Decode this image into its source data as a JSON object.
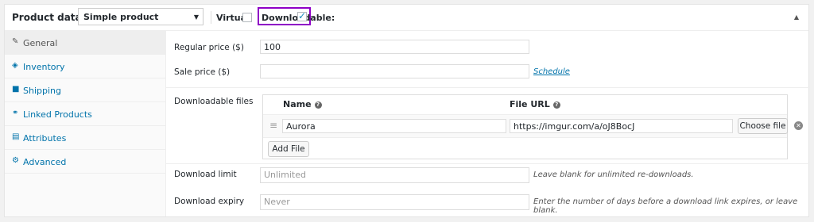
{
  "header": {
    "title": "Product data —",
    "product_type": "Simple product",
    "virtual_label": "Virtual:",
    "downloadable_label": "Downloadable:",
    "virtual_checked": false,
    "downloadable_checked": true,
    "highlight_color": "#8e00c6"
  },
  "sidebar": {
    "items": [
      {
        "label": "General",
        "icon": "wrench-icon",
        "active": true
      },
      {
        "label": "Inventory",
        "icon": "tag-icon"
      },
      {
        "label": "Shipping",
        "icon": "truck-icon"
      },
      {
        "label": "Linked Products",
        "icon": "link-icon"
      },
      {
        "label": "Attributes",
        "icon": "list-icon"
      },
      {
        "label": "Advanced",
        "icon": "gear-icon"
      }
    ]
  },
  "general": {
    "regular_price_label": "Regular price ($)",
    "regular_price_value": "100",
    "sale_price_label": "Sale price ($)",
    "sale_price_value": "",
    "schedule_link": "Schedule",
    "downloadable_files_label": "Downloadable files",
    "files_table": {
      "name_header": "Name",
      "url_header": "File URL",
      "rows": [
        {
          "name": "Aurora",
          "url": "https://imgur.com/a/oJ8BocJ",
          "choose_label": "Choose file"
        }
      ],
      "add_file_label": "Add File"
    },
    "download_limit_label": "Download limit",
    "download_limit_placeholder": "Unlimited",
    "download_limit_hint": "Leave blank for unlimited re-downloads.",
    "download_expiry_label": "Download expiry",
    "download_expiry_placeholder": "Never",
    "download_expiry_hint": "Enter the number of days before a download link expires, or leave blank."
  },
  "colors": {
    "accent": "#0073aa",
    "checkmark": "#1e8cbe"
  }
}
